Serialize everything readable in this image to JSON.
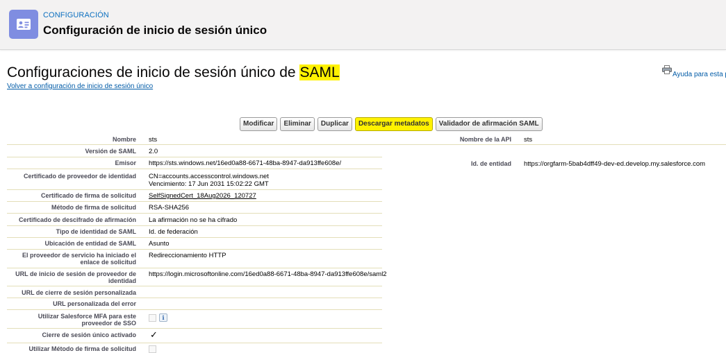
{
  "header": {
    "kicker": "CONFIGURACIÓN",
    "title": "Configuración de inicio de sesión único",
    "icon": "identity-card-icon"
  },
  "page": {
    "title_prefix": "Configuraciones de inicio de sesión único de ",
    "title_highlight": "SAML",
    "back_link": "Volver a configuración de inicio de sesión único",
    "help_link": "Ayuda para esta p"
  },
  "buttons": {
    "edit": "Modificar",
    "delete": "Eliminar",
    "clone": "Duplicar",
    "download_metadata": "Descargar metadatos",
    "saml_validator": "Validador de afirmación SAML"
  },
  "details": {
    "name": {
      "label": "Nombre",
      "value": "sts"
    },
    "saml_version": {
      "label": "Versión de SAML",
      "value": "2.0"
    },
    "issuer": {
      "label": "Emisor",
      "value": "https://sts.windows.net/16ed0a88-6671-48ba-8947-da913ffe608e/"
    },
    "idp_cert": {
      "label": "Certificado de proveedor de identidad",
      "value_line1": "CN=accounts.accesscontrol.windows.net",
      "value_line2": "Vencimiento: 17 Jun 2031 15:02:22 GMT"
    },
    "request_signing_cert": {
      "label": "Certificado de firma de solicitud",
      "value": "SelfSignedCert_18Aug2026_120727"
    },
    "request_signature_method": {
      "label": "Método de firma de solicitud",
      "value": "RSA-SHA256"
    },
    "assertion_decrypt_cert": {
      "label": "Certificado de descifrado de afirmación",
      "value": "La afirmación no se ha cifrado"
    },
    "identity_type": {
      "label": "Tipo de identidad de SAML",
      "value": "Id. de federación"
    },
    "identity_location": {
      "label": "Ubicación de entidad de SAML",
      "value": "Asunto"
    },
    "sp_initiated_binding": {
      "label_line1": "El proveedor de servicio ha iniciado el",
      "label_line2": "enlace de solicitud",
      "value": "Redireccionamiento HTTP"
    },
    "idp_login_url": {
      "label_line1": "URL de inicio de sesión de proveedor de",
      "label_line2": "identidad",
      "value": "https://login.microsoftonline.com/16ed0a88-6671-48ba-8947-da913ffe608e/saml2"
    },
    "custom_logout_url": {
      "label": "URL de cierre de sesión personalizada",
      "value": ""
    },
    "custom_error_url": {
      "label": "URL personalizada del error",
      "value": ""
    },
    "use_sf_mfa": {
      "label_line1": "Utilizar Salesforce MFA para este",
      "label_line2": "proveedor de SSO",
      "checked": false
    },
    "single_logout_enabled": {
      "label": "Cierre de sesión único activado",
      "checked": true,
      "mark": "✓"
    },
    "partial_row": {
      "label": "Utilizar Método de firma de solicitud"
    }
  },
  "right_details": {
    "api_name": {
      "label": "Nombre de la API",
      "value": "sts"
    },
    "entity_id": {
      "label": "Id. de entidad",
      "value": "https://orgfarm-5bab4dff49-dev-ed.develop.my.salesforce.com"
    }
  },
  "colors": {
    "header_bg": "#f3f2f2",
    "icon_bg": "#7f8de1",
    "link": "#015ba7",
    "highlight": "#fff200"
  }
}
